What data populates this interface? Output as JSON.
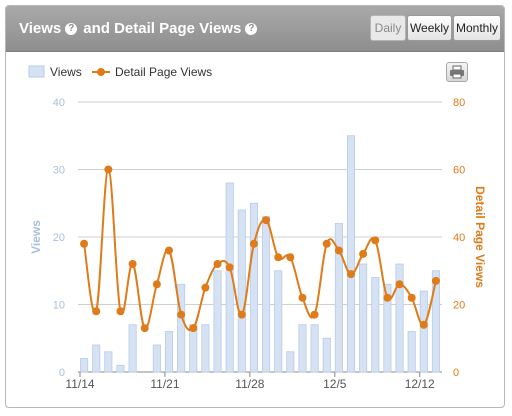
{
  "header": {
    "title_part1": "Views",
    "title_part2": "and Detail Page Views",
    "help_glyph": "?",
    "buttons": {
      "daily": "Daily",
      "weekly": "Weekly",
      "monthly": "Monthly"
    },
    "active_button": "Daily"
  },
  "chart_data": {
    "type": "bar+line",
    "title": "Views and Detail Page Views",
    "legend": {
      "position": "top-left",
      "entries": [
        "Views",
        "Detail Page Views"
      ]
    },
    "x_tick_labels": [
      {
        "index": 0,
        "label": "11/14"
      },
      {
        "index": 7,
        "label": "11/21"
      },
      {
        "index": 14,
        "label": "11/28"
      },
      {
        "index": 21,
        "label": "12/5"
      },
      {
        "index": 28,
        "label": "12/12"
      }
    ],
    "categories_count": 30,
    "grid": true,
    "series": [
      {
        "name": "Views",
        "type": "bar",
        "axis": "left",
        "color": "#d5e2f4",
        "values": [
          2,
          4,
          3,
          1,
          7,
          0,
          4,
          6,
          13,
          7,
          7,
          15,
          28,
          24,
          25,
          23,
          15,
          3,
          7,
          7,
          5,
          22,
          35,
          16,
          14,
          13,
          16,
          6,
          12,
          15
        ]
      },
      {
        "name": "Detail Page Views",
        "type": "line",
        "axis": "right",
        "color": "#e07b1a",
        "values": [
          38,
          18,
          60,
          18,
          32,
          13,
          26,
          36,
          17,
          13,
          25,
          32,
          31,
          17,
          38,
          45,
          34,
          34,
          22,
          17,
          38,
          36,
          29,
          35,
          39,
          22,
          26,
          22,
          14,
          27
        ]
      }
    ],
    "y_left": {
      "label": "Views",
      "ylim": [
        0,
        40
      ],
      "ticks": [
        "0",
        "10",
        "20",
        "30",
        "40"
      ],
      "color": "#a9bfdc"
    },
    "y_right": {
      "label": "Detail Page Views",
      "ylim": [
        0,
        80
      ],
      "ticks": [
        "0",
        "20",
        "40",
        "60",
        "80"
      ],
      "color": "#e07b1a"
    }
  }
}
